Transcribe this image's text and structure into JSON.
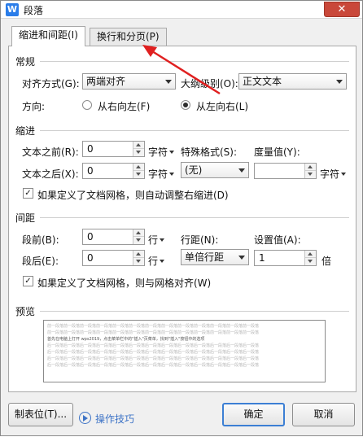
{
  "window": {
    "title": "段落",
    "app_icon_letter": "W",
    "close_glyph": "✕"
  },
  "tabs": [
    {
      "label": "缩进和间距(I)",
      "active": true
    },
    {
      "label": "换行和分页(P)",
      "active": false
    }
  ],
  "general": {
    "section": "常规",
    "alignment_label": "对齐方式(G):",
    "alignment_value": "两端对齐",
    "outline_label": "大纲级别(O):",
    "outline_value": "正文文本",
    "direction_label": "方向:",
    "direction_options": [
      "从右向左(F)",
      "从左向右(L)"
    ],
    "direction_selected": "从左向右(L)"
  },
  "indent": {
    "section": "缩进",
    "before_label": "文本之前(R):",
    "before_value": "0",
    "before_unit": "字符",
    "after_label": "文本之后(X):",
    "after_value": "0",
    "after_unit": "字符",
    "special_label": "特殊格式(S):",
    "special_value": "(无)",
    "measure_label": "度量值(Y):",
    "measure_value": "",
    "measure_unit": "字符",
    "auto_adjust_label": "如果定义了文档网格，则自动调整右缩进(D)",
    "auto_adjust_checked": true
  },
  "spacing": {
    "section": "间距",
    "before_label": "段前(B):",
    "before_value": "0",
    "before_unit": "行",
    "after_label": "段后(E):",
    "after_value": "0",
    "after_unit": "行",
    "line_spacing_label": "行距(N):",
    "line_spacing_value": "单倍行距",
    "setting_label": "设置值(A):",
    "setting_value": "1",
    "setting_unit": "倍",
    "snap_grid_label": "如果定义了文档网格，则与网格对齐(W)",
    "snap_grid_checked": true
  },
  "preview": {
    "section": "预览",
    "prev_lines": [
      "前一段落前一段落前一段落前一段落前一段落前一段落前一段落前一段落前一段落前一段落前一段落前一段落前一段落",
      "前一段落前一段落前一段落前一段落前一段落前一段落前一段落前一段落前一段落前一段落前一段落前一段落前一段落"
    ],
    "current_line": "首先在电脑上打开 wps2019，点击菜单栏中的\"插入\"页菜单，找到\"插入\"按钮中的选项",
    "next_lines": [
      "后一段落后一段落后一段落后一段落后一段落后一段落后一段落后一段落后一段落后一段落后一段落后一段落后一段落",
      "后一段落后一段落后一段落后一段落后一段落后一段落后一段落后一段落后一段落后一段落后一段落后一段落后一段落",
      "后一段落后一段落后一段落后一段落后一段落后一段落后一段落后一段落后一段落后一段落后一段落后一段落后一段落",
      "后一段落后一段落后一段落后一段落后一段落后一段落后一段落后一段落后一段落后一段落后一段落后一段落后一段落"
    ]
  },
  "footer": {
    "tabs_button": "制表位(T)...",
    "tips_label": "操作技巧",
    "ok": "确定",
    "cancel": "取消"
  },
  "colors": {
    "accent": "#3c7fd4",
    "close": "#c9483a",
    "annotation_arrow": "#e02020",
    "link": "#3d73c6"
  }
}
